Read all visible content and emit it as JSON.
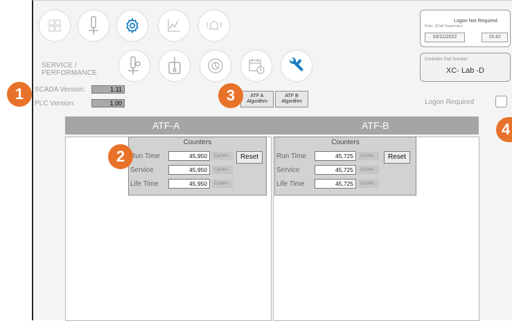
{
  "section": {
    "line1": "SERVICE /",
    "line2": "PERFORMANCE"
  },
  "versions": {
    "scada_label": "SCADA Version:",
    "scada_value": "1.11",
    "plc_label": "PLC Version:",
    "plc_value": "1.00"
  },
  "algorithms": {
    "atf_a": {
      "line1": "ATF A",
      "line2": "Algorithm"
    },
    "atf_b": {
      "line1": "ATF B",
      "line2": "Algorithm"
    }
  },
  "logon": {
    "status": "Logon Not Required",
    "role": "Role: XCell Supervisor",
    "date": "03/11/2022",
    "time": "15:42",
    "required_label": "Logon Required"
  },
  "controller": {
    "label": "Controller Part Number:",
    "value": "XC- Lab -D"
  },
  "atf_a": {
    "title": "ATF-A",
    "counters_title": "Counters",
    "run_time_label": "Run Time",
    "run_time_value": "45,950",
    "run_time_unit": "Cycles",
    "service_label": "Service",
    "service_value": "45,950",
    "service_unit": "Cycles",
    "life_time_label": "Life Time",
    "life_time_value": "45,950",
    "life_time_unit": "Cycles",
    "reset_label": "Reset"
  },
  "atf_b": {
    "title": "ATF-B",
    "counters_title": "Counters",
    "run_time_label": "Run Time",
    "run_time_value": "45,725",
    "run_time_unit": "Cycles",
    "service_label": "Service",
    "service_value": "45,725",
    "service_unit": "Cycles",
    "life_time_label": "Life Time",
    "life_time_value": "45,725",
    "life_time_unit": "Cycles",
    "reset_label": "Reset"
  },
  "callouts": [
    "1",
    "2",
    "3",
    "4"
  ],
  "icons": {
    "top_row": [
      "grid-icon",
      "probe-icon",
      "gear-icon",
      "chart-icon",
      "alarm-bell-icon"
    ],
    "second_row": [
      "probe-plus-icon",
      "probe-box-icon",
      "gauge-icon",
      "calendar-clock-icon",
      "wrench-screwdriver-icon"
    ]
  },
  "colors": {
    "accent_blue": "#1e7fc2",
    "callout_orange": "#e8722a",
    "header_gray": "#a5a5a5"
  }
}
